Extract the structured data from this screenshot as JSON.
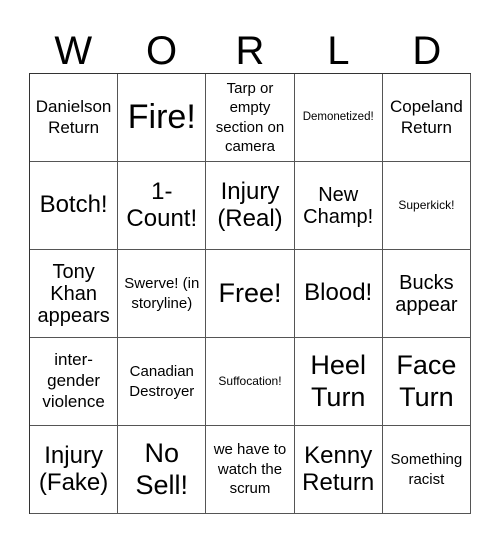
{
  "header": {
    "letters": [
      "W",
      "O",
      "R",
      "L",
      "D"
    ]
  },
  "board": {
    "rows": [
      [
        "Danielson Return",
        "Fire!",
        "Tarp or empty section on camera",
        "Demonetized!",
        "Copeland Return"
      ],
      [
        "Botch!",
        "1-Count!",
        "Injury (Real)",
        "New Champ!",
        "Superkick!"
      ],
      [
        "Tony Khan appears",
        "Swerve! (in storyline)",
        "Free!",
        "Blood!",
        "Bucks appear"
      ],
      [
        "inter-gender violence",
        "Canadian Destroyer",
        "Suffocation!",
        "Heel Turn",
        "Face Turn"
      ],
      [
        "Injury (Fake)",
        "No Sell!",
        "we have to watch the scrum",
        "Kenny Return",
        "Something racist"
      ]
    ]
  }
}
